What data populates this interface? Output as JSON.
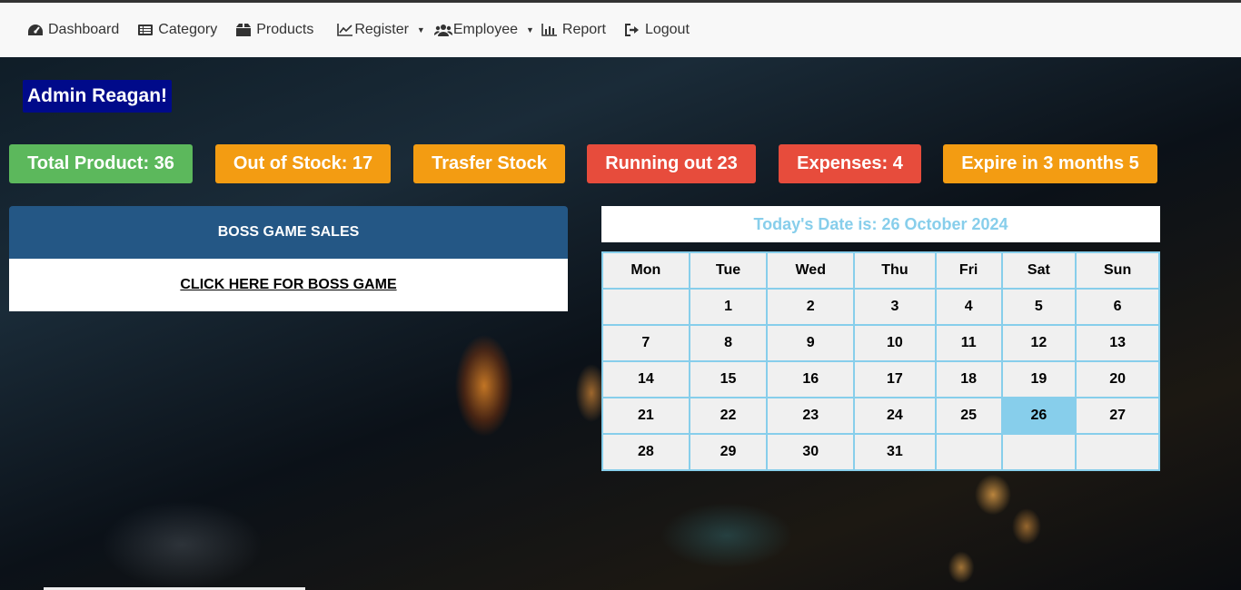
{
  "nav": {
    "dashboard": "Dashboard",
    "category": "Category",
    "products": "Products",
    "register": "Register",
    "employee": "Employee",
    "report": "Report",
    "logout": "Logout"
  },
  "admin_greeting": "Admin Reagan!",
  "stats": [
    {
      "label": "Total Product: 36",
      "color": "#5cb85c"
    },
    {
      "label": "Out of Stock: 17",
      "color": "#f39c12"
    },
    {
      "label": "Trasfer Stock",
      "color": "#f39c12"
    },
    {
      "label": "Running out 23",
      "color": "#e74c3c"
    },
    {
      "label": "Expenses: 4",
      "color": "#e74c3c"
    },
    {
      "label": "Expire in 3 months 5",
      "color": "#f39c12"
    }
  ],
  "panel": {
    "title": "BOSS GAME SALES",
    "link": "CLICK HERE FOR BOSS GAME"
  },
  "calendar": {
    "date_label": "Today's Date is: 26 October 2024",
    "today": "26",
    "days": [
      "Mon",
      "Tue",
      "Wed",
      "Thu",
      "Fri",
      "Sat",
      "Sun"
    ],
    "weeks": [
      [
        "",
        "1",
        "2",
        "3",
        "4",
        "5",
        "6"
      ],
      [
        "7",
        "8",
        "9",
        "10",
        "11",
        "12",
        "13"
      ],
      [
        "14",
        "15",
        "16",
        "17",
        "18",
        "19",
        "20"
      ],
      [
        "21",
        "22",
        "23",
        "24",
        "25",
        "26",
        "27"
      ],
      [
        "28",
        "29",
        "30",
        "31",
        "",
        "",
        ""
      ]
    ]
  }
}
